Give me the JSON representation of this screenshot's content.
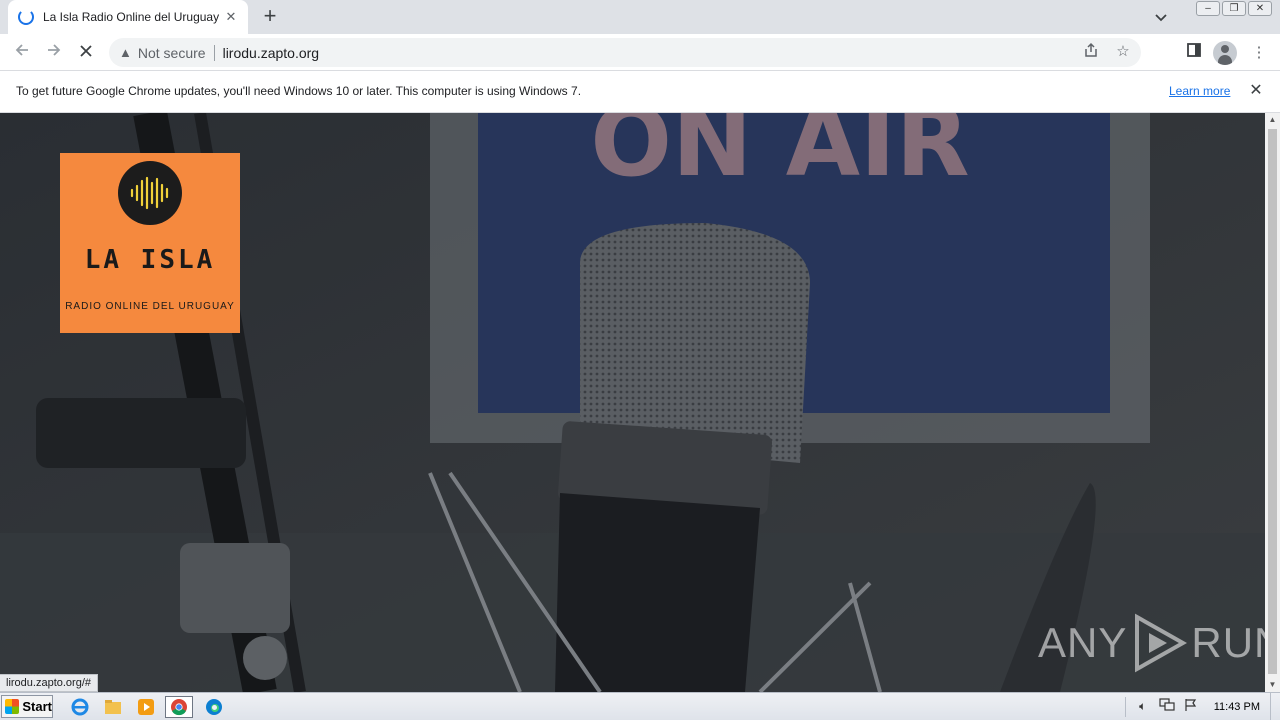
{
  "browser": {
    "tab_title": "La Isla Radio Online del Uruguay - Li",
    "tab_close_glyph": "✕",
    "new_tab_glyph": "+",
    "not_secure_label": "Not secure",
    "url": "lirodu.zapto.org",
    "status_url": "lirodu.zapto.org/#"
  },
  "infobar": {
    "message": "To get future Google Chrome updates, you'll need Windows 10 or later. This computer is using Windows 7.",
    "link_label": "Learn more"
  },
  "page": {
    "logo_title": "LA ISLA",
    "logo_subtitle": "RADIO ONLINE DEL URUGUAY",
    "background_sign": "ON AIR"
  },
  "watermark": {
    "left": "ANY",
    "right": "RUN"
  },
  "taskbar": {
    "start_label": "Start",
    "clock": "11:43 PM",
    "apps": [
      "internet-explorer",
      "file-explorer",
      "media-player",
      "chrome",
      "edge"
    ]
  },
  "colors": {
    "logo_orange": "#f5893e",
    "logo_wave": "#f0d13a",
    "link_blue": "#1a73e8"
  }
}
